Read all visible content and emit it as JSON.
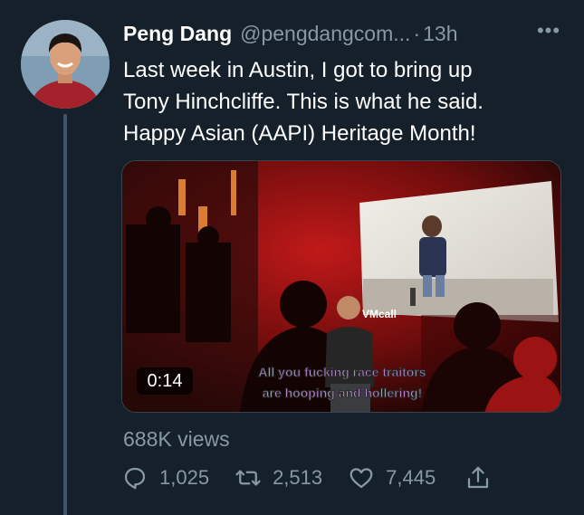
{
  "tweet": {
    "author_name": "Peng Dang",
    "handle": "@pengdangcom...",
    "separator": "·",
    "time": "13h",
    "more_label": "•••",
    "text_lines": [
      "Last week in Austin, I got to bring up",
      "Tony Hinchcliffe. This is what he said.",
      "Happy Asian (AAPI) Heritage Month!"
    ]
  },
  "media": {
    "duration": "0:14",
    "caption_lines": [
      "All you fucking race traitors",
      "are hooping and hollering!"
    ],
    "screen_logo": "VMcall"
  },
  "stats": {
    "views": "688K views",
    "replies": "1,025",
    "retweets": "2,513",
    "likes": "7,445"
  },
  "icons": {
    "reply": "reply-icon",
    "retweet": "retweet-icon",
    "like": "heart-icon",
    "share": "share-icon",
    "more": "more-icon"
  },
  "colors": {
    "background": "#15202b",
    "secondary_text": "#8899a6",
    "thread_line": "#3d5466",
    "caption_fill": "#c58fe0"
  }
}
